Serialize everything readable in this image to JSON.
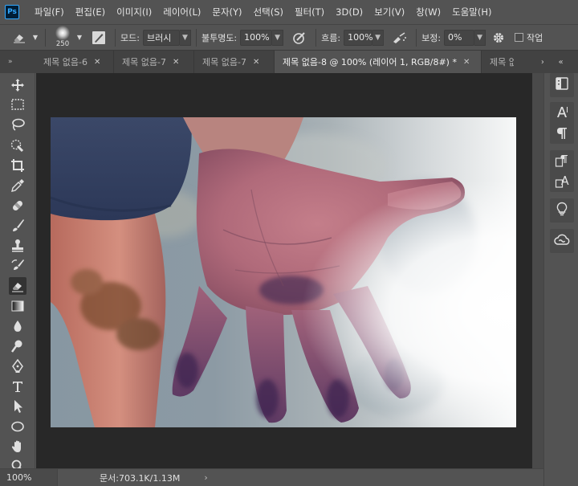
{
  "app": {
    "logo": "Ps"
  },
  "menu": [
    "파일(F)",
    "편집(E)",
    "이미지(I)",
    "레이어(L)",
    "문자(Y)",
    "선택(S)",
    "필터(T)",
    "3D(D)",
    "보기(V)",
    "창(W)",
    "도움말(H)"
  ],
  "options": {
    "brush_size": "250",
    "mode_label": "모드:",
    "mode_value": "브러시",
    "opacity_label": "불투명도:",
    "opacity_value": "100%",
    "flow_label": "흐름:",
    "flow_value": "100%",
    "smoothing_label": "보정:",
    "smoothing_value": "0%",
    "checkbox_label": "작업"
  },
  "tabs": [
    {
      "label": "제목 없음-6",
      "active": false
    },
    {
      "label": "제목 없음-7",
      "active": false
    },
    {
      "label": "제목 없음-7",
      "active": false
    },
    {
      "label": "제목 없음-8 @ 100% (레이어 1, RGB/8#) *",
      "active": true
    },
    {
      "label": "제목 없",
      "active": false
    }
  ],
  "status": {
    "zoom": "100%",
    "doc_info": "문서:703.1K/1.13M",
    "arrow": "›"
  },
  "colors": {
    "bg": "#535353",
    "canvas": "#282828",
    "accent": "#31a8ff"
  },
  "icons": {
    "collapse_left": "«",
    "collapse_right": "»",
    "tab_close": "✕"
  }
}
